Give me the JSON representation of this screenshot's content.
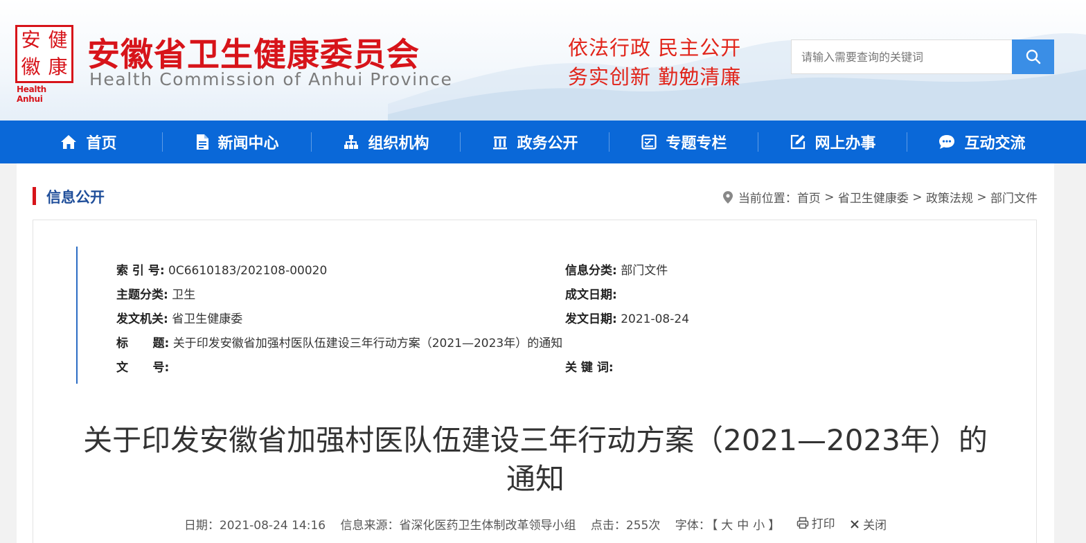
{
  "header": {
    "logo_chars": [
      "安",
      "健",
      "徽",
      "康"
    ],
    "logo_en": "Health Anhui",
    "org_cn": "安徽省卫生健康委员会",
    "org_en": "Health Commission of Anhui Province",
    "slogan_line1": "依法行政  民主公开",
    "slogan_line2": "务实创新  勤勉清廉",
    "search_placeholder": "请输入需要查询的关键词",
    "brand_color": "#d7141a"
  },
  "nav": {
    "color": "#0a68d8",
    "items": [
      {
        "label": "首页",
        "icon": "home-icon"
      },
      {
        "label": "新闻中心",
        "icon": "document-icon"
      },
      {
        "label": "组织机构",
        "icon": "org-chart-icon"
      },
      {
        "label": "政务公开",
        "icon": "building-icon"
      },
      {
        "label": "专题专栏",
        "icon": "topic-icon"
      },
      {
        "label": "网上办事",
        "icon": "edit-icon"
      },
      {
        "label": "互动交流",
        "icon": "chat-icon"
      }
    ]
  },
  "section": {
    "title": "信息公开",
    "breadcrumb_prefix": "当前位置：",
    "breadcrumb": [
      "首页",
      "省卫生健康委",
      "政策法规",
      "部门文件"
    ]
  },
  "meta": {
    "index_no_label": "索 引 号:",
    "index_no": "0C6610183/202108-00020",
    "category_label": "信息分类:",
    "category": "部门文件",
    "topic_label": "主题分类:",
    "topic": "卫生",
    "written_date_label": "成文日期:",
    "written_date": "",
    "issuer_label": "发文机关:",
    "issuer": "省卫生健康委",
    "issue_date_label": "发文日期:",
    "issue_date": "2021-08-24",
    "title_label": "标      题:",
    "title": "关于印发安徽省加强村医队伍建设三年行动方案（2021—2023年）的通知",
    "doc_no_label": "文      号:",
    "doc_no": "",
    "keywords_label": "关 键 词:",
    "keywords": ""
  },
  "article": {
    "title": "关于印发安徽省加强村医队伍建设三年行动方案（2021—2023年）的通知",
    "date_label": "日期：",
    "date": "2021-08-24 14:16",
    "source_label": "信息来源：",
    "source": "省深化医药卫生体制改革领导小组",
    "clicks_label": "点击：",
    "clicks": "255次",
    "font_label": "字体：",
    "font_sizes": [
      "【",
      "大",
      "中",
      "小",
      "】"
    ],
    "print_label": "打印",
    "close_label": "关闭"
  }
}
